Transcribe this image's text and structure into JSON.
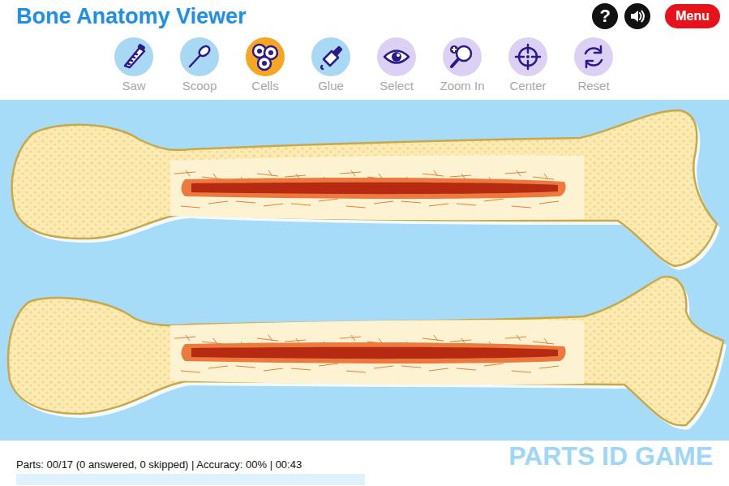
{
  "header": {
    "title": "Bone Anatomy Viewer",
    "help": "?",
    "menu": "Menu"
  },
  "tools": [
    {
      "label": "Saw",
      "color": "#a9d8f5"
    },
    {
      "label": "Scoop",
      "color": "#a9d8f5"
    },
    {
      "label": "Cells",
      "color": "#f6a623"
    },
    {
      "label": "Glue",
      "color": "#a9d8f5"
    },
    {
      "label": "Select",
      "color": "#ddd0f5"
    },
    {
      "label": "Zoom In",
      "color": "#ddd0f5"
    },
    {
      "label": "Center",
      "color": "#ddd0f5"
    },
    {
      "label": "Reset",
      "color": "#ddd0f5"
    }
  ],
  "status_bar": {
    "text": "Parts: 00/17 (0 answered, 0 skipped) | Accuracy: 00% | 00:43",
    "progress": {
      "level": 0
    }
  },
  "game_label": "PARTS ID GAME"
}
